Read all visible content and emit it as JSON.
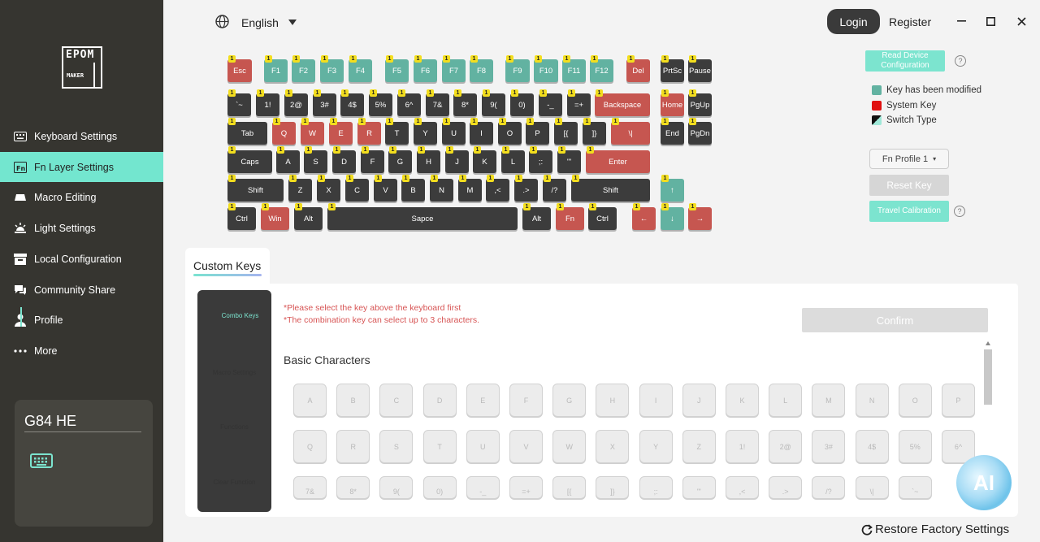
{
  "logo": {
    "top": "EPOM",
    "bottom": "MAKER"
  },
  "sidebar": {
    "items": [
      {
        "label": "Keyboard Settings",
        "icon": "keyboard-icon"
      },
      {
        "label": "Fn Layer Settings",
        "icon": "fn-icon",
        "active": true
      },
      {
        "label": "Macro Editing",
        "icon": "macro-icon"
      },
      {
        "label": "Light Settings",
        "icon": "light-icon"
      },
      {
        "label": "Local Configuration",
        "icon": "local-config-icon"
      },
      {
        "label": "Community Share",
        "icon": "community-icon"
      },
      {
        "label": "Profile",
        "icon": "profile-icon"
      },
      {
        "label": "More",
        "icon": "more-icon"
      }
    ],
    "device": {
      "name": "G84 HE"
    }
  },
  "topbar": {
    "language": "English",
    "login": "Login",
    "register": "Register"
  },
  "keyboard": {
    "badge": "1",
    "colors": {
      "dark": "#3c3c3c",
      "system": "#c65650",
      "modified": "#62b2a1"
    }
  },
  "right_panel": {
    "read_config": "Read Device Configuration",
    "legend": [
      {
        "label": "Key has been modified",
        "color": "#62b2a1"
      },
      {
        "label": "System Key",
        "color": "#e01010"
      },
      {
        "label": "Switch Type",
        "color": "#111111"
      }
    ],
    "profile": "Fn Profile 1",
    "reset_key": "Reset Key",
    "travel_calibration": "Travel Calibration"
  },
  "custom_keys": {
    "tab": "Custom Keys",
    "menu": [
      "Combo Keys",
      "Macro Settings",
      "Functions",
      "Clear Function"
    ],
    "hint1": "*Please select the key above the keyboard first",
    "hint2": "*The combination key can select up to 3 characters.",
    "confirm": "Confirm",
    "section_title": "Basic Characters",
    "rows": [
      [
        "A",
        "B",
        "C",
        "D",
        "E",
        "F",
        "G",
        "H",
        "I",
        "J",
        "K",
        "L",
        "M",
        "N",
        "O",
        "P"
      ],
      [
        "Q",
        "R",
        "S",
        "T",
        "U",
        "V",
        "W",
        "X",
        "Y",
        "Z",
        "1!",
        "2@",
        "3#",
        "4$",
        "5%",
        "6^"
      ],
      [
        "7&",
        "8*",
        "9(",
        "0)",
        "-_",
        "=+",
        "[{",
        "]}",
        ";:",
        "'\"",
        ",<",
        ".>",
        "/?",
        "\\|",
        "`~"
      ]
    ]
  },
  "ai_label": "AI",
  "restore": "Restore Factory Settings"
}
